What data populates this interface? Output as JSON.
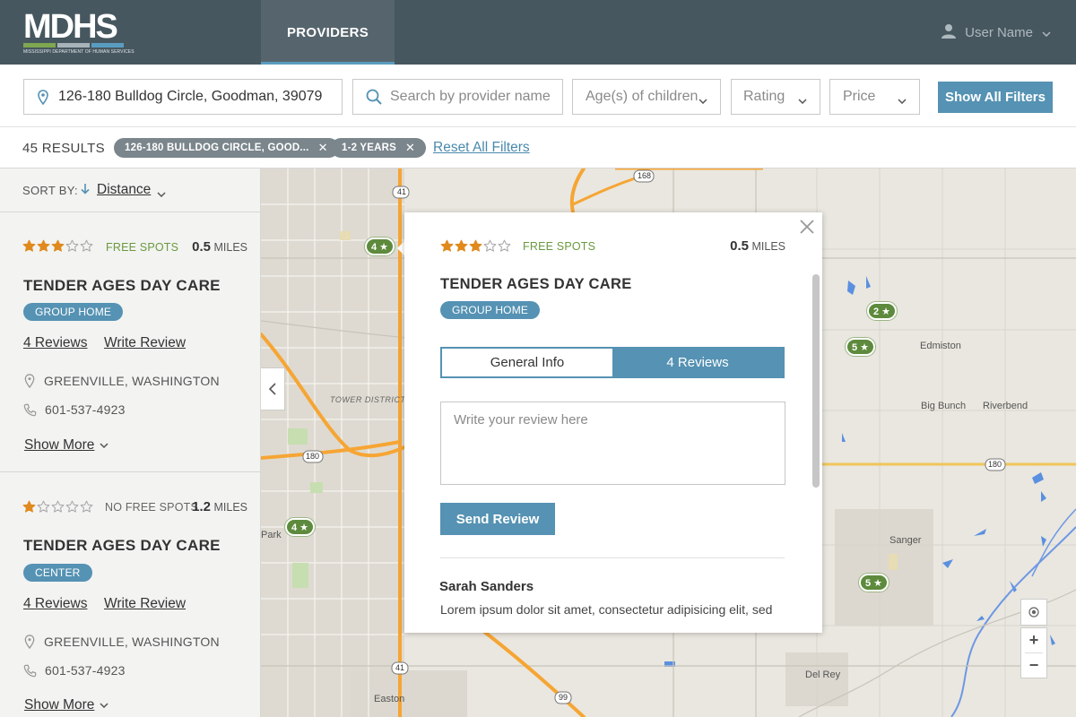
{
  "header": {
    "logo_text": "MDHS",
    "logo_subtitle": "MISSISSIPPI DEPARTMENT OF HUMAN SERVICES",
    "nav_tab": "PROVIDERS",
    "user_name": "User Name"
  },
  "filters": {
    "location_value": "126-180 Bulldog Circle, Goodman, 39079",
    "search_placeholder": "Search by provider name",
    "ages_label": "Age(s) of children",
    "rating_label": "Rating",
    "price_label": "Price",
    "show_all_label": "Show All Filters"
  },
  "results": {
    "count": "45 RESULTS",
    "chips": [
      "126-180 BULLDOG CIRCLE, GOOD...",
      "1-2 YEARS"
    ],
    "reset_label": "Reset All Filters"
  },
  "sort": {
    "label": "SORT BY:",
    "value": "Distance"
  },
  "providers": [
    {
      "rating": 3,
      "spots": "FREE SPOTS",
      "distance": "0.5",
      "distance_unit": "MILES",
      "name": "TENDER AGES DAY CARE",
      "type": "GROUP HOME",
      "reviews_label": "4 Reviews",
      "write_review_label": "Write Review",
      "location": "GREENVILLE, WASHINGTON",
      "phone": "601-537-4923",
      "show_more": "Show More"
    },
    {
      "rating": 1,
      "spots": "NO FREE SPOTS",
      "distance": "1.2",
      "distance_unit": "MILES",
      "name": "TENDER AGES DAY CARE",
      "type": "CENTER",
      "reviews_label": "4 Reviews",
      "write_review_label": "Write Review",
      "location": "GREENVILLE, WASHINGTON",
      "phone": "601-537-4923",
      "show_more": "Show More"
    }
  ],
  "map": {
    "pins": [
      "4 ★",
      "2 ★",
      "5 ★",
      "4 ★",
      "5 ★"
    ],
    "places": [
      "TOWER DISTRICT",
      "Edmiston",
      "Big Bunch",
      "Riverbend",
      "Sanger",
      "Park",
      "Del Rey",
      "Easton"
    ],
    "road_shields": [
      "41",
      "168",
      "180",
      "180",
      "41",
      "99"
    ],
    "zoom_in": "+",
    "zoom_out": "−"
  },
  "popup": {
    "rating": 3,
    "spots": "FREE SPOTS",
    "distance": "0.5",
    "distance_unit": "MILES",
    "name": "TENDER AGES DAY CARE",
    "type": "GROUP HOME",
    "tab_general": "General Info",
    "tab_reviews": "4 Reviews",
    "review_placeholder": "Write your review here",
    "send_label": "Send Review",
    "reviewer_name": "Sarah Sanders",
    "review_text": "Lorem ipsum dolor sit amet, consectetur adipisicing elit, sed"
  },
  "colors": {
    "header_bg": "#47575f",
    "accent": "#5592b3",
    "free_spots": "#6a9a3e",
    "star": "#e08a1e",
    "pin": "#5d8a3c"
  }
}
